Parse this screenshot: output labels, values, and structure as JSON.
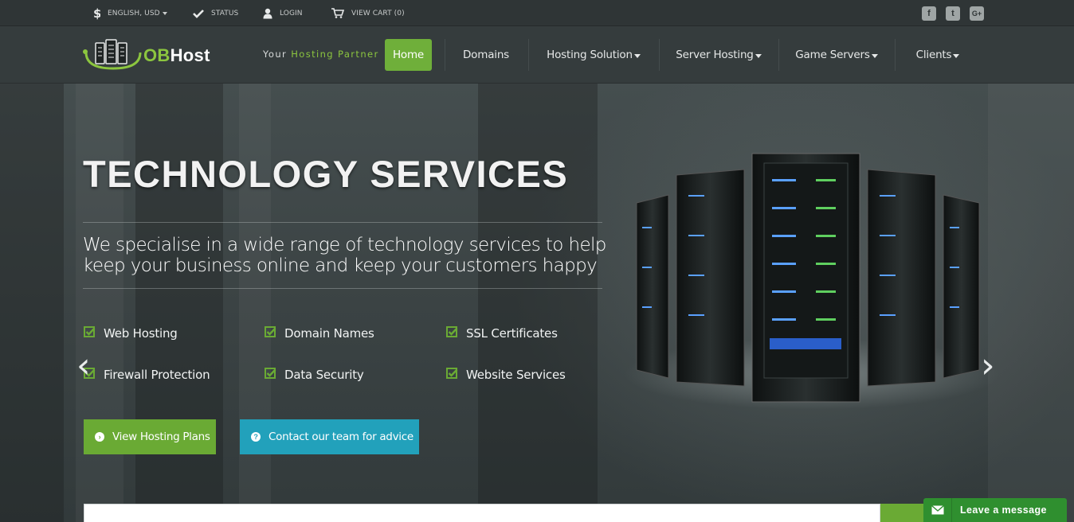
{
  "topbar": {
    "language": "ENGLISH, USD",
    "status": "STATUS",
    "login": "LOGIN",
    "cart": "VIEW CART (0)",
    "social": [
      {
        "icon": "facebook-icon",
        "glyph": "f"
      },
      {
        "icon": "twitter-icon",
        "glyph": "t"
      },
      {
        "icon": "google-plus-icon",
        "glyph": "G+"
      }
    ]
  },
  "header": {
    "logo_ob": "OB",
    "logo_host": "Host",
    "tagline_prefix": "Your",
    "tagline_highlight": "Hosting Partner"
  },
  "nav": {
    "home": "Home",
    "domains": "Domains",
    "hosting_solution": "Hosting Solution",
    "server_hosting": "Server Hosting",
    "game_servers": "Game Servers",
    "clients": "Clients"
  },
  "hero": {
    "title": "TECHNOLOGY SERVICES",
    "description": "We specialise in a wide range of technology services to help keep your business online and keep your customers happy",
    "features": [
      "Web Hosting",
      "Domain Names",
      "SSL Certificates",
      "Firewall Protection",
      "Data Security",
      "Website Services"
    ],
    "primary_button": "View Hosting Plans",
    "secondary_button": "Contact our team for advice",
    "prev_arrow": "‹",
    "next_arrow": "›"
  },
  "chat": {
    "label": "Leave a message"
  },
  "colors": {
    "accent_green": "#6aaa34",
    "brand_green": "#8cc63f",
    "accent_blue": "#22a1bb"
  }
}
